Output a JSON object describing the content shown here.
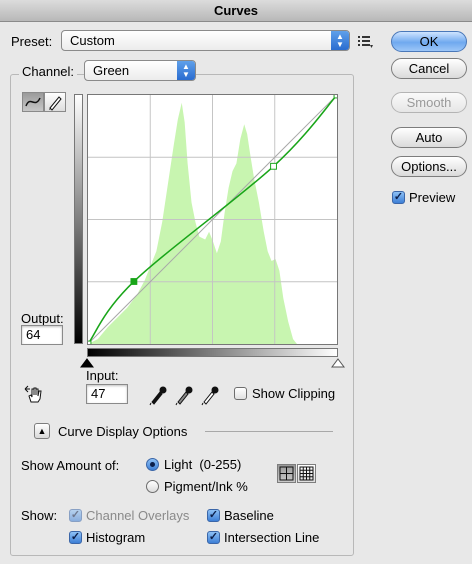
{
  "window": {
    "title": "Curves"
  },
  "preset": {
    "label": "Preset:",
    "value": "Custom"
  },
  "channel": {
    "label": "Channel:",
    "value": "Green"
  },
  "buttons": {
    "ok": "OK",
    "cancel": "Cancel",
    "smooth": "Smooth",
    "auto": "Auto",
    "options": "Options..."
  },
  "preview": {
    "label": "Preview",
    "checked": true
  },
  "output": {
    "label": "Output:",
    "value": "64"
  },
  "input": {
    "label": "Input:",
    "value": "47"
  },
  "show_clipping": {
    "label": "Show Clipping",
    "checked": false
  },
  "curve_display_options": {
    "label": "Curve Display Options"
  },
  "show_amount": {
    "label": "Show Amount of:",
    "options": [
      {
        "label": "Light  (0-255)",
        "selected": true
      },
      {
        "label": "Pigment/Ink %",
        "selected": false
      }
    ]
  },
  "show": {
    "label": "Show:",
    "options": [
      {
        "label": "Channel Overlays",
        "checked": true,
        "enabled": false
      },
      {
        "label": "Baseline",
        "checked": true,
        "enabled": true
      },
      {
        "label": "Histogram",
        "checked": true,
        "enabled": true
      },
      {
        "label": "Intersection Line",
        "checked": true,
        "enabled": true
      }
    ]
  },
  "colors": {
    "histogram": "#c8f5b0",
    "curve": "#19a519",
    "accent": "#3d7fd6"
  },
  "curve_points": [
    [
      0,
      0
    ],
    [
      47,
      64
    ],
    [
      190,
      182
    ],
    [
      255,
      255
    ]
  ]
}
